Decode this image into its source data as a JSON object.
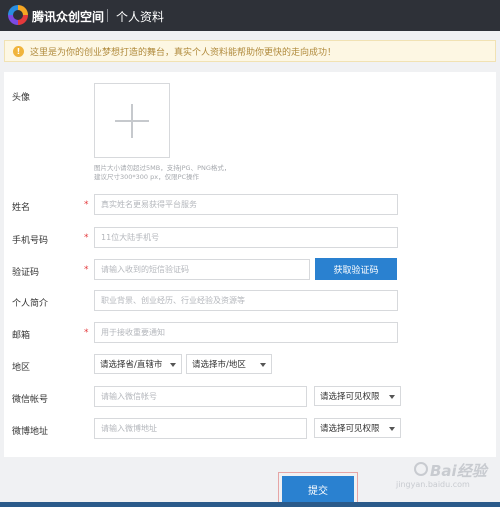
{
  "header": {
    "brand": "腾讯众创空间",
    "title": "个人资料"
  },
  "notice": {
    "icon": "!",
    "text": "这里是为你的创业梦想打造的舞台，真实个人资料能帮助你更快的走向成功！"
  },
  "form": {
    "avatar": {
      "label": "头像",
      "hint_line1": "图片大小请勿超过5MB，支持JPG、PNG格式，",
      "hint_line2": "建议尺寸300*300 px，仅限PC操作"
    },
    "name": {
      "label": "姓名",
      "required_mark": "*",
      "placeholder": "真实姓名更易获得平台服务"
    },
    "phone": {
      "label": "手机号码",
      "required_mark": "*",
      "placeholder": "11位大陆手机号"
    },
    "code": {
      "label": "验证码",
      "required_mark": "*",
      "placeholder": "请输入收到的短信验证码",
      "button": "获取验证码"
    },
    "bio": {
      "label": "个人简介",
      "placeholder": "职业背景、创业经历、行业经验及资源等"
    },
    "email": {
      "label": "邮箱",
      "required_mark": "*",
      "placeholder": "用于接收重要通知"
    },
    "region": {
      "label": "地区",
      "province": "请选择省/直辖市",
      "city": "请选择市/地区"
    },
    "wechat": {
      "label": "微信帐号",
      "placeholder": "请输入微信帐号",
      "visibility": "请选择可见权限"
    },
    "weibo": {
      "label": "微博地址",
      "placeholder": "请输入微博地址",
      "visibility": "请选择可见权限"
    },
    "submit": "提交"
  },
  "watermark": {
    "text": "Bai经验",
    "sub": "jingyan.baidu.com"
  }
}
